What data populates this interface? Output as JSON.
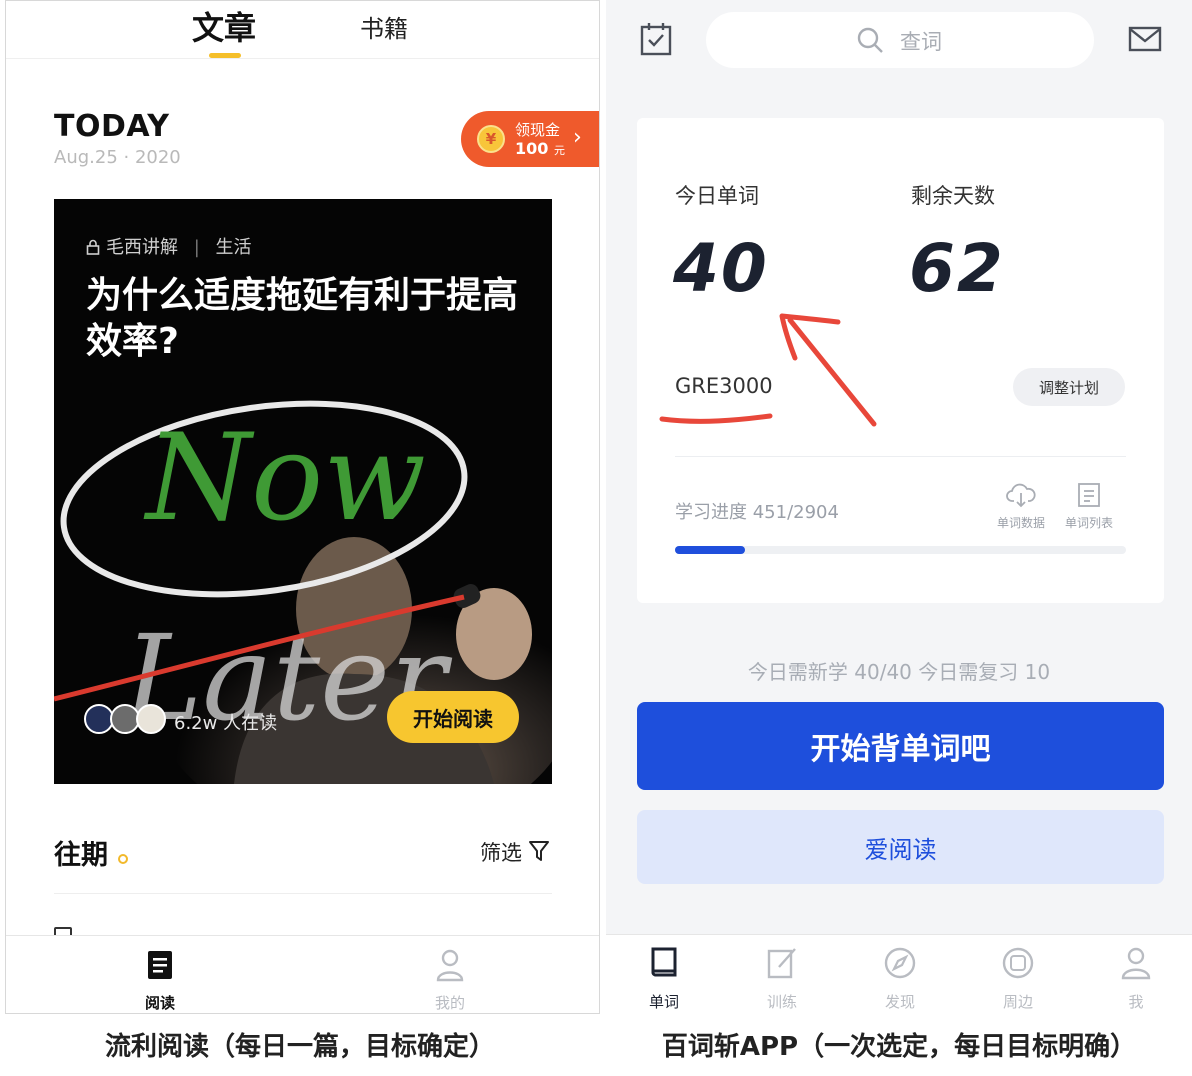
{
  "left_app": {
    "tabs": [
      {
        "label": "文章",
        "active": true
      },
      {
        "label": "书籍",
        "active": false
      }
    ],
    "today_label": "TODAY",
    "date": "Aug.25 · 2020",
    "cash_pill": {
      "line1": "领现金",
      "amount": "100",
      "unit": "元",
      "coin_symbol": "¥"
    },
    "article": {
      "meta_category": "毛西讲解",
      "meta_separator": "|",
      "meta_tag": "生活",
      "title": "为什么适度拖延有利于提高效率?",
      "art_word_now": "Now",
      "art_word_later": "Later",
      "readers": "6.2w 人在读",
      "cta": "开始阅读"
    },
    "past_section": {
      "title": "往期",
      "filter_label": "筛选"
    },
    "bottom_nav": [
      {
        "label": "阅读",
        "icon": "article-icon",
        "active": true
      },
      {
        "label": "我的",
        "icon": "user-icon",
        "active": false
      }
    ],
    "colors": {
      "accent": "#f7c62f",
      "pill": "#ef5a2c"
    }
  },
  "right_app": {
    "search": {
      "placeholder": "查词"
    },
    "plan": {
      "today_words_label": "今日单词",
      "today_words_value": "40",
      "days_left_label": "剩余天数",
      "days_left_value": "62",
      "book": "GRE3000",
      "adjust_label": "调整计划",
      "progress_label": "学习进度 451/2904",
      "progress_fraction": 0.155,
      "tools": [
        {
          "label": "单词数据",
          "icon": "cloud-download-icon"
        },
        {
          "label": "单词列表",
          "icon": "list-icon"
        }
      ]
    },
    "today_need": "今日需新学 40/40  今日需复习 10",
    "start_button": "开始背单词吧",
    "read_button": "爱阅读",
    "bottom_nav": [
      {
        "label": "单词",
        "icon": "book-icon",
        "active": true
      },
      {
        "label": "训练",
        "icon": "edit-icon",
        "active": false
      },
      {
        "label": "发现",
        "icon": "compass-icon",
        "active": false
      },
      {
        "label": "周边",
        "icon": "taobao-icon",
        "active": false
      },
      {
        "label": "我",
        "icon": "user-icon",
        "active": false
      }
    ],
    "colors": {
      "primary": "#1e4fdc",
      "secondary_bg": "#dfe7fb",
      "annotation": "#e8473a"
    }
  },
  "captions": {
    "left": "流利阅读（每日一篇，目标确定）",
    "right": "百词斩APP（一次选定，每日目标明确）"
  }
}
